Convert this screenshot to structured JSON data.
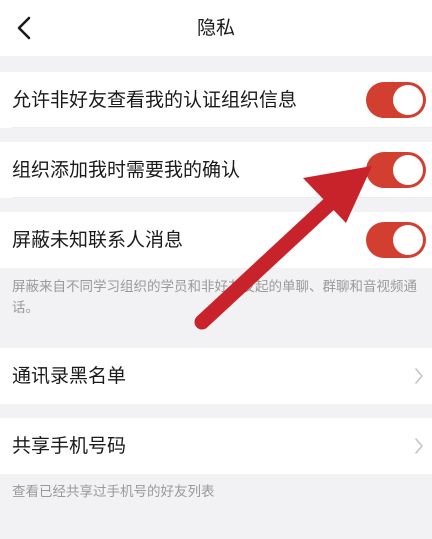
{
  "header": {
    "title": "隐私",
    "back_icon": "chevron-left-icon"
  },
  "settings": {
    "toggles": [
      {
        "label": "允许非好友查看我的认证组织信息",
        "enabled": true
      },
      {
        "label": "组织添加我时需要我的确认",
        "enabled": true
      },
      {
        "label": "屏蔽未知联系人消息",
        "enabled": true
      }
    ],
    "mute_note": "屏蔽来自不同学习组织的学员和非好友发起的单聊、群聊和音视频通话。",
    "links": [
      {
        "label": "通讯录黑名单"
      },
      {
        "label": "共享手机号码"
      }
    ],
    "share_note": "查看已经共享过手机号的好友列表"
  },
  "colors": {
    "toggle_on": "#d23f31",
    "annotation_arrow": "#c8232a",
    "page_background": "#f2f2f4"
  }
}
